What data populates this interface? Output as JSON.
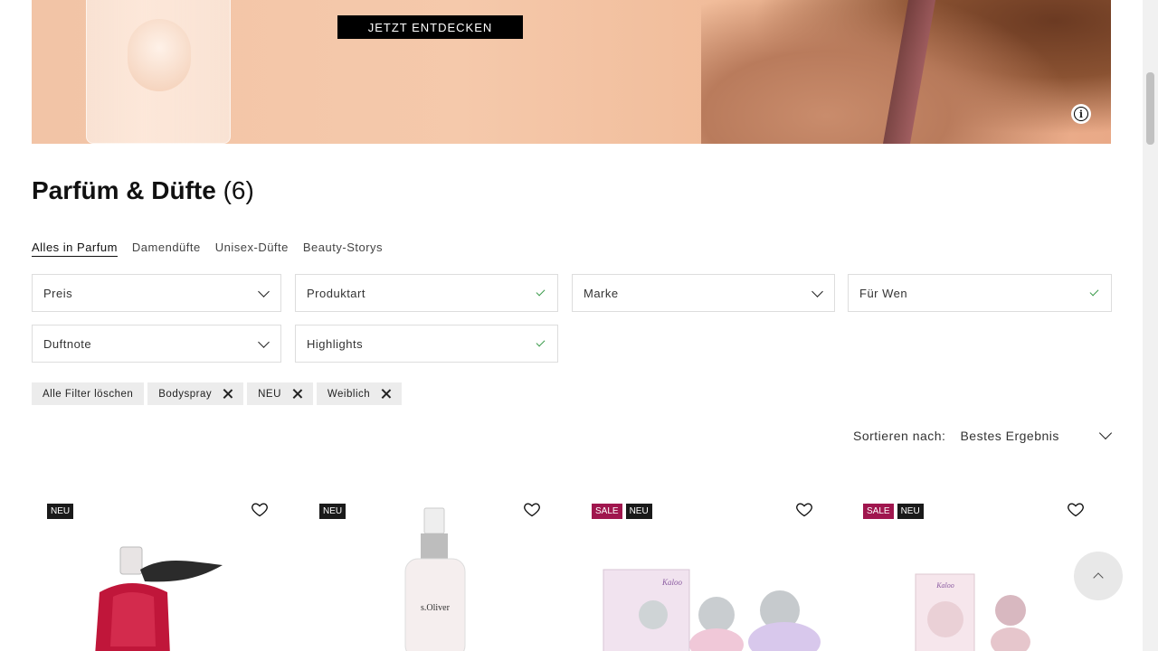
{
  "hero": {
    "cta_label": "JETZT ENTDECKEN",
    "info_icon": "info-icon"
  },
  "title": {
    "main": "Parfüm & Düfte",
    "count": "(6)"
  },
  "tabs": [
    {
      "label": "Alles in Parfum",
      "active": true
    },
    {
      "label": "Damendüfte",
      "active": false
    },
    {
      "label": "Unisex-Düfte",
      "active": false
    },
    {
      "label": "Beauty-Storys",
      "active": false
    }
  ],
  "filters": [
    {
      "label": "Preis",
      "state": "chevron"
    },
    {
      "label": "Produktart",
      "state": "check"
    },
    {
      "label": "Marke",
      "state": "chevron"
    },
    {
      "label": "Für Wen",
      "state": "check"
    },
    {
      "label": "Duftnote",
      "state": "chevron"
    },
    {
      "label": "Highlights",
      "state": "check"
    }
  ],
  "chips": {
    "clear_all": "Alle Filter löschen",
    "active": [
      "Bodyspray",
      "NEU",
      "Weiblich"
    ]
  },
  "sort": {
    "label": "Sortieren nach:",
    "value": "Bestes Ergebnis"
  },
  "products": [
    {
      "badges": [
        "NEU"
      ]
    },
    {
      "badges": [
        "NEU"
      ],
      "brand_text": "s.Oliver"
    },
    {
      "badges": [
        "SALE",
        "NEU"
      ],
      "brand_text": "Kaloo"
    },
    {
      "badges": [
        "SALE",
        "NEU"
      ],
      "brand_text": "Kaloo"
    }
  ],
  "colors": {
    "sale_badge": "#a0164e",
    "new_badge": "#1a1a1a",
    "check": "#3a9a4a"
  }
}
